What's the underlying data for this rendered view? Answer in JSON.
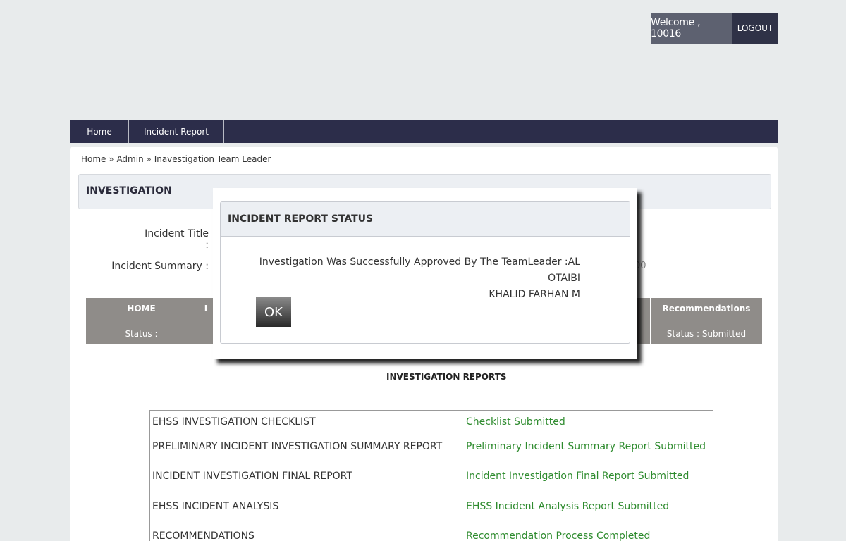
{
  "header": {
    "welcome_text": "Welcome , 10016",
    "logout_label": "LOGOUT"
  },
  "nav": {
    "items": [
      {
        "label": "Home"
      },
      {
        "label": "Incident Report"
      }
    ]
  },
  "breadcrumb": {
    "items": [
      "Home",
      "Admin",
      "Inavestigation Team Leader"
    ],
    "separator": "»"
  },
  "panel": {
    "title": "INVESTIGATION"
  },
  "fields": {
    "incident_title_label": "Incident Title :",
    "incident_summary_label": "Incident Summary :",
    "partial_value": "00"
  },
  "status_bar": {
    "home": {
      "name": "HOME",
      "status": "Status :"
    },
    "next_partial": "I",
    "recommendations": {
      "name": "Recommendations",
      "status": "Status : Submitted"
    }
  },
  "reports": {
    "title": "INVESTIGATION REPORTS",
    "rows": [
      {
        "name": "EHSS INVESTIGATION CHECKLIST",
        "status": "Checklist Submitted"
      },
      {
        "name": "PRELIMINARY INCIDENT INVESTIGATION SUMMARY REPORT",
        "status": "Preliminary Incident Summary Report Submitted"
      },
      {
        "name": "INCIDENT INVESTIGATION FINAL REPORT",
        "status": "Incident Investigation Final Report Submitted"
      },
      {
        "name": "EHSS INCIDENT ANALYSIS",
        "status": "EHSS Incident Analysis Report Submitted"
      },
      {
        "name": "RECOMMENDATIONS",
        "status": "Recommendation Process Completed"
      }
    ]
  },
  "dialog": {
    "title": "INCIDENT REPORT STATUS",
    "message_line1": "Investigation Was Successfully Approved By The TeamLeader :AL OTAIBI",
    "message_line2": "KHALID FARHAN M",
    "ok_label": "OK"
  },
  "colors": {
    "nav_bg": "#2c2d4a",
    "status_submitted": "#2e8b2e",
    "status_bar_bg": "#8f8c89"
  }
}
